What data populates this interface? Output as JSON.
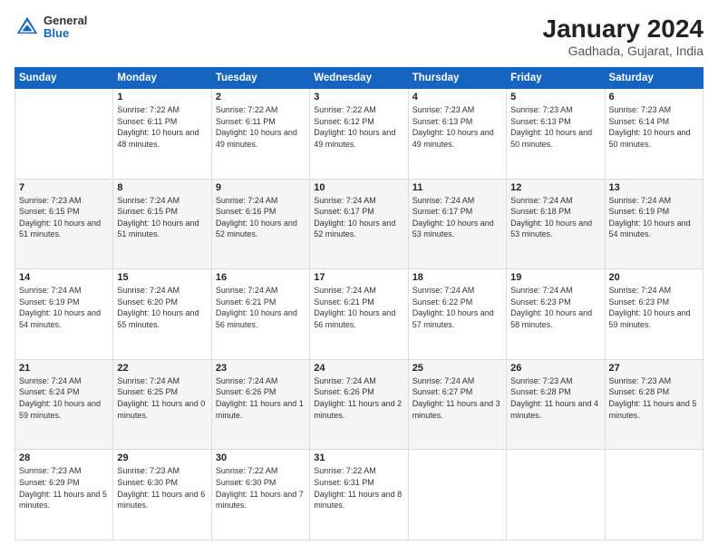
{
  "header": {
    "logo": {
      "general": "General",
      "blue": "Blue"
    },
    "title": "January 2024",
    "location": "Gadhada, Gujarat, India"
  },
  "weekdays": [
    "Sunday",
    "Monday",
    "Tuesday",
    "Wednesday",
    "Thursday",
    "Friday",
    "Saturday"
  ],
  "weeks": [
    [
      {
        "day": null
      },
      {
        "day": "1",
        "sunrise": "7:22 AM",
        "sunset": "6:11 PM",
        "daylight": "10 hours and 48 minutes."
      },
      {
        "day": "2",
        "sunrise": "7:22 AM",
        "sunset": "6:11 PM",
        "daylight": "10 hours and 49 minutes."
      },
      {
        "day": "3",
        "sunrise": "7:22 AM",
        "sunset": "6:12 PM",
        "daylight": "10 hours and 49 minutes."
      },
      {
        "day": "4",
        "sunrise": "7:23 AM",
        "sunset": "6:13 PM",
        "daylight": "10 hours and 49 minutes."
      },
      {
        "day": "5",
        "sunrise": "7:23 AM",
        "sunset": "6:13 PM",
        "daylight": "10 hours and 50 minutes."
      },
      {
        "day": "6",
        "sunrise": "7:23 AM",
        "sunset": "6:14 PM",
        "daylight": "10 hours and 50 minutes."
      }
    ],
    [
      {
        "day": "7",
        "sunrise": "7:23 AM",
        "sunset": "6:15 PM",
        "daylight": "10 hours and 51 minutes."
      },
      {
        "day": "8",
        "sunrise": "7:24 AM",
        "sunset": "6:15 PM",
        "daylight": "10 hours and 51 minutes."
      },
      {
        "day": "9",
        "sunrise": "7:24 AM",
        "sunset": "6:16 PM",
        "daylight": "10 hours and 52 minutes."
      },
      {
        "day": "10",
        "sunrise": "7:24 AM",
        "sunset": "6:17 PM",
        "daylight": "10 hours and 52 minutes."
      },
      {
        "day": "11",
        "sunrise": "7:24 AM",
        "sunset": "6:17 PM",
        "daylight": "10 hours and 53 minutes."
      },
      {
        "day": "12",
        "sunrise": "7:24 AM",
        "sunset": "6:18 PM",
        "daylight": "10 hours and 53 minutes."
      },
      {
        "day": "13",
        "sunrise": "7:24 AM",
        "sunset": "6:19 PM",
        "daylight": "10 hours and 54 minutes."
      }
    ],
    [
      {
        "day": "14",
        "sunrise": "7:24 AM",
        "sunset": "6:19 PM",
        "daylight": "10 hours and 54 minutes."
      },
      {
        "day": "15",
        "sunrise": "7:24 AM",
        "sunset": "6:20 PM",
        "daylight": "10 hours and 55 minutes."
      },
      {
        "day": "16",
        "sunrise": "7:24 AM",
        "sunset": "6:21 PM",
        "daylight": "10 hours and 56 minutes."
      },
      {
        "day": "17",
        "sunrise": "7:24 AM",
        "sunset": "6:21 PM",
        "daylight": "10 hours and 56 minutes."
      },
      {
        "day": "18",
        "sunrise": "7:24 AM",
        "sunset": "6:22 PM",
        "daylight": "10 hours and 57 minutes."
      },
      {
        "day": "19",
        "sunrise": "7:24 AM",
        "sunset": "6:23 PM",
        "daylight": "10 hours and 58 minutes."
      },
      {
        "day": "20",
        "sunrise": "7:24 AM",
        "sunset": "6:23 PM",
        "daylight": "10 hours and 59 minutes."
      }
    ],
    [
      {
        "day": "21",
        "sunrise": "7:24 AM",
        "sunset": "6:24 PM",
        "daylight": "10 hours and 59 minutes."
      },
      {
        "day": "22",
        "sunrise": "7:24 AM",
        "sunset": "6:25 PM",
        "daylight": "11 hours and 0 minutes."
      },
      {
        "day": "23",
        "sunrise": "7:24 AM",
        "sunset": "6:26 PM",
        "daylight": "11 hours and 1 minute."
      },
      {
        "day": "24",
        "sunrise": "7:24 AM",
        "sunset": "6:26 PM",
        "daylight": "11 hours and 2 minutes."
      },
      {
        "day": "25",
        "sunrise": "7:24 AM",
        "sunset": "6:27 PM",
        "daylight": "11 hours and 3 minutes."
      },
      {
        "day": "26",
        "sunrise": "7:23 AM",
        "sunset": "6:28 PM",
        "daylight": "11 hours and 4 minutes."
      },
      {
        "day": "27",
        "sunrise": "7:23 AM",
        "sunset": "6:28 PM",
        "daylight": "11 hours and 5 minutes."
      }
    ],
    [
      {
        "day": "28",
        "sunrise": "7:23 AM",
        "sunset": "6:29 PM",
        "daylight": "11 hours and 5 minutes."
      },
      {
        "day": "29",
        "sunrise": "7:23 AM",
        "sunset": "6:30 PM",
        "daylight": "11 hours and 6 minutes."
      },
      {
        "day": "30",
        "sunrise": "7:22 AM",
        "sunset": "6:30 PM",
        "daylight": "11 hours and 7 minutes."
      },
      {
        "day": "31",
        "sunrise": "7:22 AM",
        "sunset": "6:31 PM",
        "daylight": "11 hours and 8 minutes."
      },
      {
        "day": null
      },
      {
        "day": null
      },
      {
        "day": null
      }
    ]
  ],
  "labels": {
    "sunrise": "Sunrise:",
    "sunset": "Sunset:",
    "daylight": "Daylight:"
  }
}
